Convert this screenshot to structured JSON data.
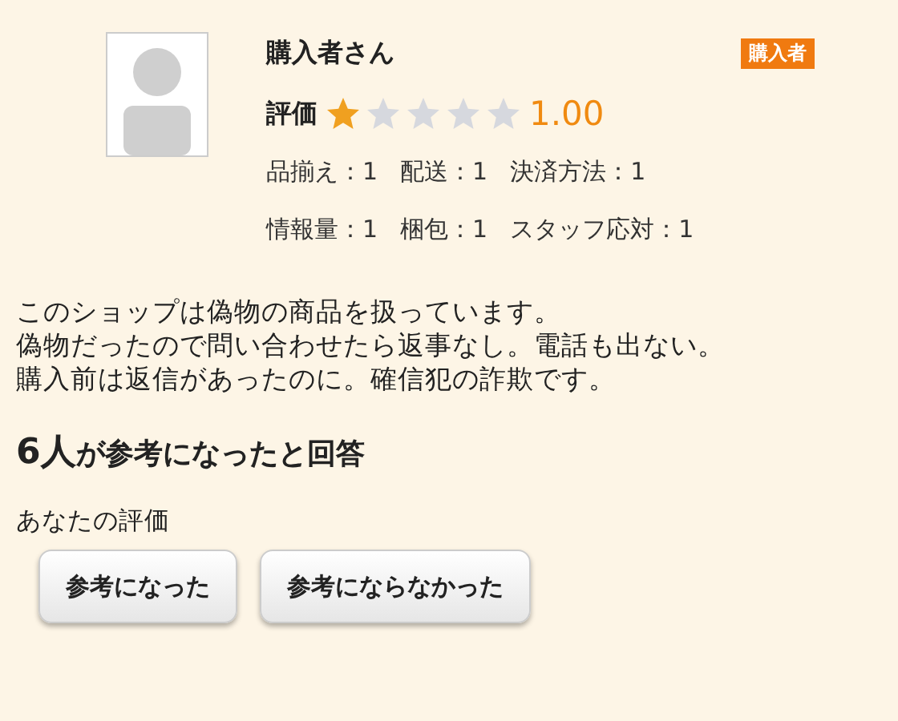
{
  "reviewer": {
    "name": "購入者さん",
    "badge": "購入者",
    "rating_label": "評価",
    "stars": 1,
    "rating": "1.00",
    "scores": [
      [
        "品揃え：1",
        "配送：1",
        "決済方法：1"
      ],
      [
        "情報量：1",
        "梱包：1",
        "スタッフ応対：1"
      ]
    ]
  },
  "review_lines": [
    "このショップは偽物の商品を扱っています。",
    "偽物だったので問い合わせたら返事なし。電話も出ない。",
    "購入前は返信があったのに。確信犯の詐欺です。"
  ],
  "helpful": {
    "count": "6人",
    "text": "が参考になったと回答"
  },
  "your_rating_label": "あなたの評価",
  "buttons": [
    "参考になった",
    "参考にならなかった"
  ]
}
